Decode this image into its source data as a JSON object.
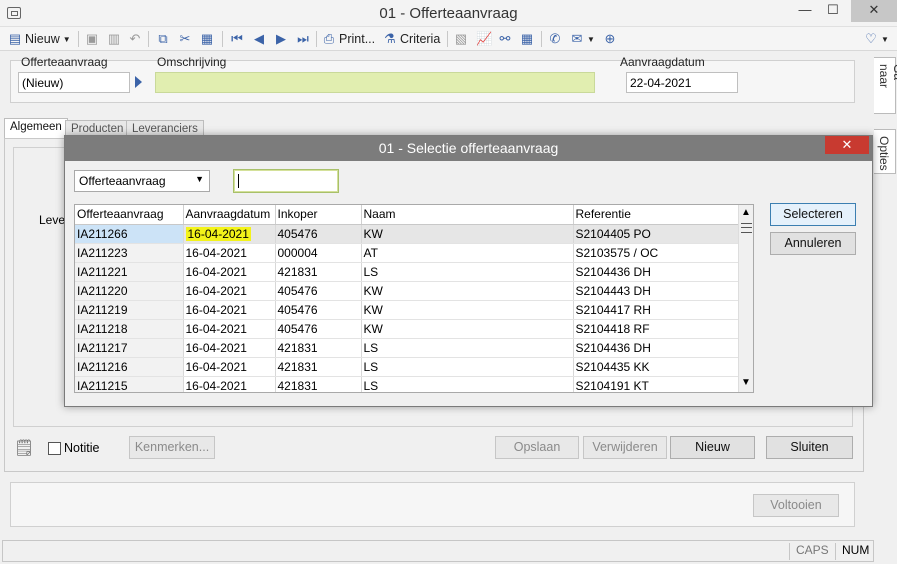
{
  "window": {
    "title": "01 - Offerteaanvraag",
    "minimize": "—",
    "maximize": "☐",
    "close": "✕"
  },
  "toolbar": {
    "new_label": "Nieuw",
    "print_label": "Print...",
    "criteria_label": "Criteria"
  },
  "header": {
    "offerte_label": "Offerteaanvraag",
    "offerte_value": "(Nieuw)",
    "omschrijving_label": "Omschrijving",
    "omschrijving_value": "",
    "datum_label": "Aanvraagdatum",
    "datum_value": "22-04-2021"
  },
  "side_tabs": [
    "Ga naar",
    "Opties"
  ],
  "tabs": [
    "Algemeen",
    "Producten",
    "Leveranciers"
  ],
  "panel": {
    "partial_label": "Leve"
  },
  "bottom": {
    "notitie_label": "Notitie",
    "kenmerken_label": "Kenmerken...",
    "opslaan_label": "Opslaan",
    "verwijderen_label": "Verwijderen",
    "nieuw_label": "Nieuw",
    "sluiten_label": "Sluiten",
    "voltooien_label": "Voltooien"
  },
  "dialog": {
    "title": "01 - Selectie offerteaanvraag",
    "close": "✕",
    "filter_selected": "Offerteaanvraag",
    "filter_value": "",
    "select_label": "Selecteren",
    "cancel_label": "Annuleren",
    "columns": [
      "Offerteaanvraag",
      "Aanvraagdatum",
      "Inkoper",
      "Naam",
      "Referentie"
    ],
    "rows": [
      [
        "IA211266",
        "16-04-2021",
        "405476",
        "KW",
        "S2104405 PO"
      ],
      [
        "IA211223",
        "16-04-2021",
        "000004",
        "AT",
        "S2103575 / OC"
      ],
      [
        "IA211221",
        "16-04-2021",
        "421831",
        "LS",
        "S2104436 DH"
      ],
      [
        "IA211220",
        "16-04-2021",
        "405476",
        "KW",
        "S2104443 DH"
      ],
      [
        "IA211219",
        "16-04-2021",
        "405476",
        "KW",
        "S2104417 RH"
      ],
      [
        "IA211218",
        "16-04-2021",
        "405476",
        "KW",
        "S2104418 RF"
      ],
      [
        "IA211217",
        "16-04-2021",
        "421831",
        "LS",
        "S2104436 DH"
      ],
      [
        "IA211216",
        "16-04-2021",
        "421831",
        "LS",
        "S2104435 KK"
      ],
      [
        "IA211215",
        "16-04-2021",
        "421831",
        "LS",
        "S2104191 KT"
      ]
    ]
  },
  "status": {
    "caps": "CAPS",
    "num": "NUM"
  },
  "colors": {
    "highlight": "#f3f31a",
    "selected_row": "#cce3f7",
    "dialog_title_bg": "#7c7c7c",
    "close_red": "#c83a30"
  }
}
